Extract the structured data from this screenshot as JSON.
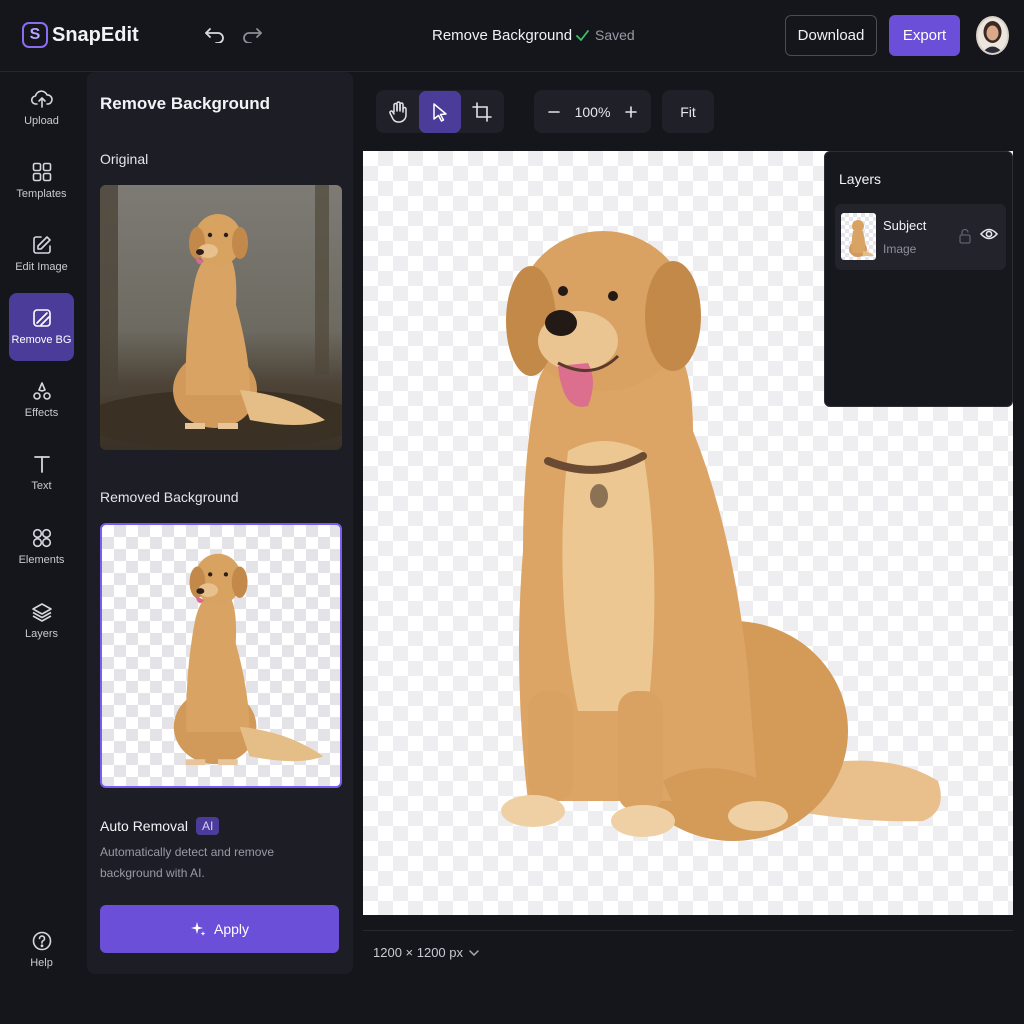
{
  "app": {
    "name": "SnapEdit",
    "logo_letter": "S"
  },
  "header": {
    "document_title": "Remove Background",
    "status": "Saved",
    "download_label": "Download",
    "export_label": "Export"
  },
  "rail": {
    "items": [
      {
        "label": "Upload",
        "icon": "upload-icon",
        "active": false
      },
      {
        "label": "Templates",
        "icon": "templates-icon",
        "active": false
      },
      {
        "label": "Edit Image",
        "icon": "edit-image-icon",
        "active": false
      },
      {
        "label": "Remove BG",
        "icon": "remove-bg-icon",
        "active": true
      },
      {
        "label": "Effects",
        "icon": "effects-icon",
        "active": false
      },
      {
        "label": "Text",
        "icon": "text-icon",
        "active": false
      },
      {
        "label": "Elements",
        "icon": "elements-icon",
        "active": false
      },
      {
        "label": "Layers",
        "icon": "layers-icon",
        "active": false
      }
    ],
    "help_label": "Help"
  },
  "panel": {
    "title": "Remove Background",
    "original_label": "Original",
    "removed_label": "Removed Background",
    "auto_title": "Auto Removal",
    "ai_badge": "AI",
    "auto_desc": "Automatically detect and remove background with AI.",
    "apply_label": "Apply"
  },
  "toolbar": {
    "tools": [
      "hand-icon",
      "select-pointer-icon",
      "crop-icon"
    ],
    "active_tool": "select-pointer-icon",
    "zoom": "100%",
    "fit_label": "Fit"
  },
  "canvas": {
    "size_readout": "1200 × 1200 px"
  },
  "layers": {
    "title": "Layers",
    "items": [
      {
        "name": "Subject",
        "type": "Image"
      }
    ]
  },
  "colors": {
    "accent": "#6b4fd8",
    "accent_active_bg": "#4b3c9a",
    "background": "#15161b",
    "panel": "#1d1e25",
    "saved_check": "#3fbf6a"
  }
}
